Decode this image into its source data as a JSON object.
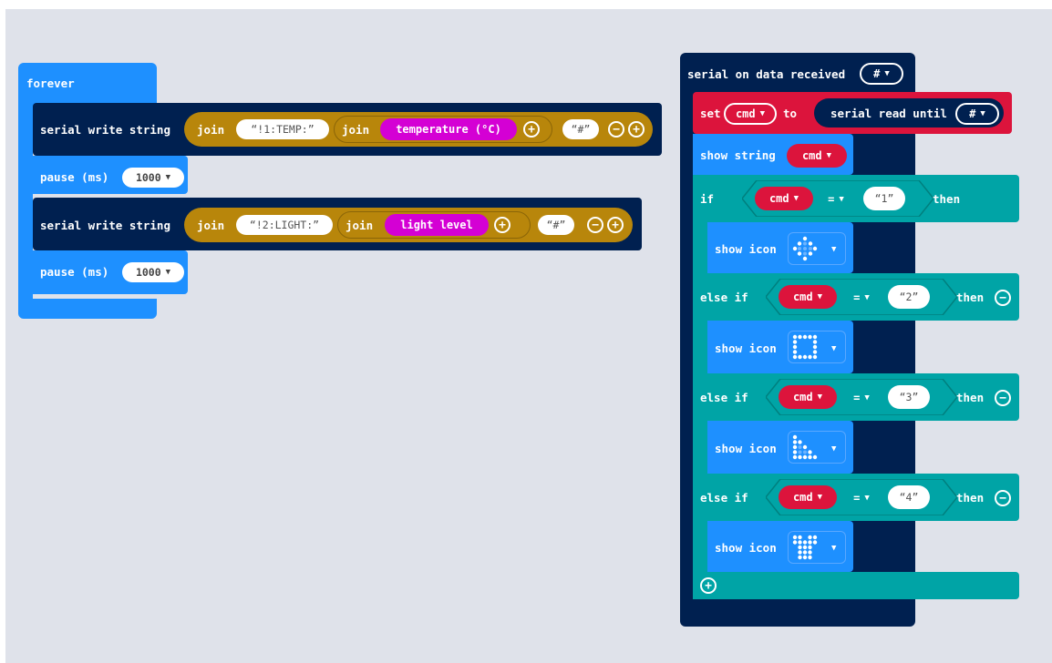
{
  "colors": {
    "loops": "#1e90ff",
    "serial": "#002050",
    "text": "#b8860b",
    "input": "#d400d4",
    "variables": "#dc143c",
    "logic": "#00a4a6",
    "basic": "#1e90ff"
  },
  "forever_stack": {
    "hat_label": "forever",
    "statements": [
      {
        "label": "serial write string",
        "join_outer": "join",
        "first_string": "!1:TEMP:",
        "join_inner": "join",
        "sensor": "temperature (°C)",
        "second_string": "#",
        "plus_icon": "add-icon",
        "minus_icon": "remove-icon"
      },
      {
        "label": "pause (ms)",
        "value": "1000"
      },
      {
        "label": "serial write string",
        "join_outer": "join",
        "first_string": "!2:LIGHT:",
        "join_inner": "join",
        "sensor": "light level",
        "second_string": "#",
        "plus_icon": "add-icon",
        "minus_icon": "remove-icon"
      },
      {
        "label": "pause (ms)",
        "value": "1000"
      }
    ]
  },
  "serial_stack": {
    "hat_label": "serial on data received",
    "hat_delimiter": "#",
    "set_label": "set",
    "set_variable": "cmd",
    "to_label": "to",
    "read_label": "serial read until",
    "read_delimiter": "#",
    "show_string_label": "show string",
    "show_string_var": "cmd",
    "if_label": "if",
    "else_if_label": "else if",
    "then_label": "then",
    "compare_var": "cmd",
    "compare_op": "=",
    "show_icon_label": "show icon",
    "branches": [
      {
        "value": "1",
        "icon": "diamond-icon"
      },
      {
        "value": "2",
        "icon": "square-icon"
      },
      {
        "value": "3",
        "icon": "triangle-icon"
      },
      {
        "value": "4",
        "icon": "tshirt-icon"
      }
    ],
    "add_branch_icon": "add-icon"
  }
}
